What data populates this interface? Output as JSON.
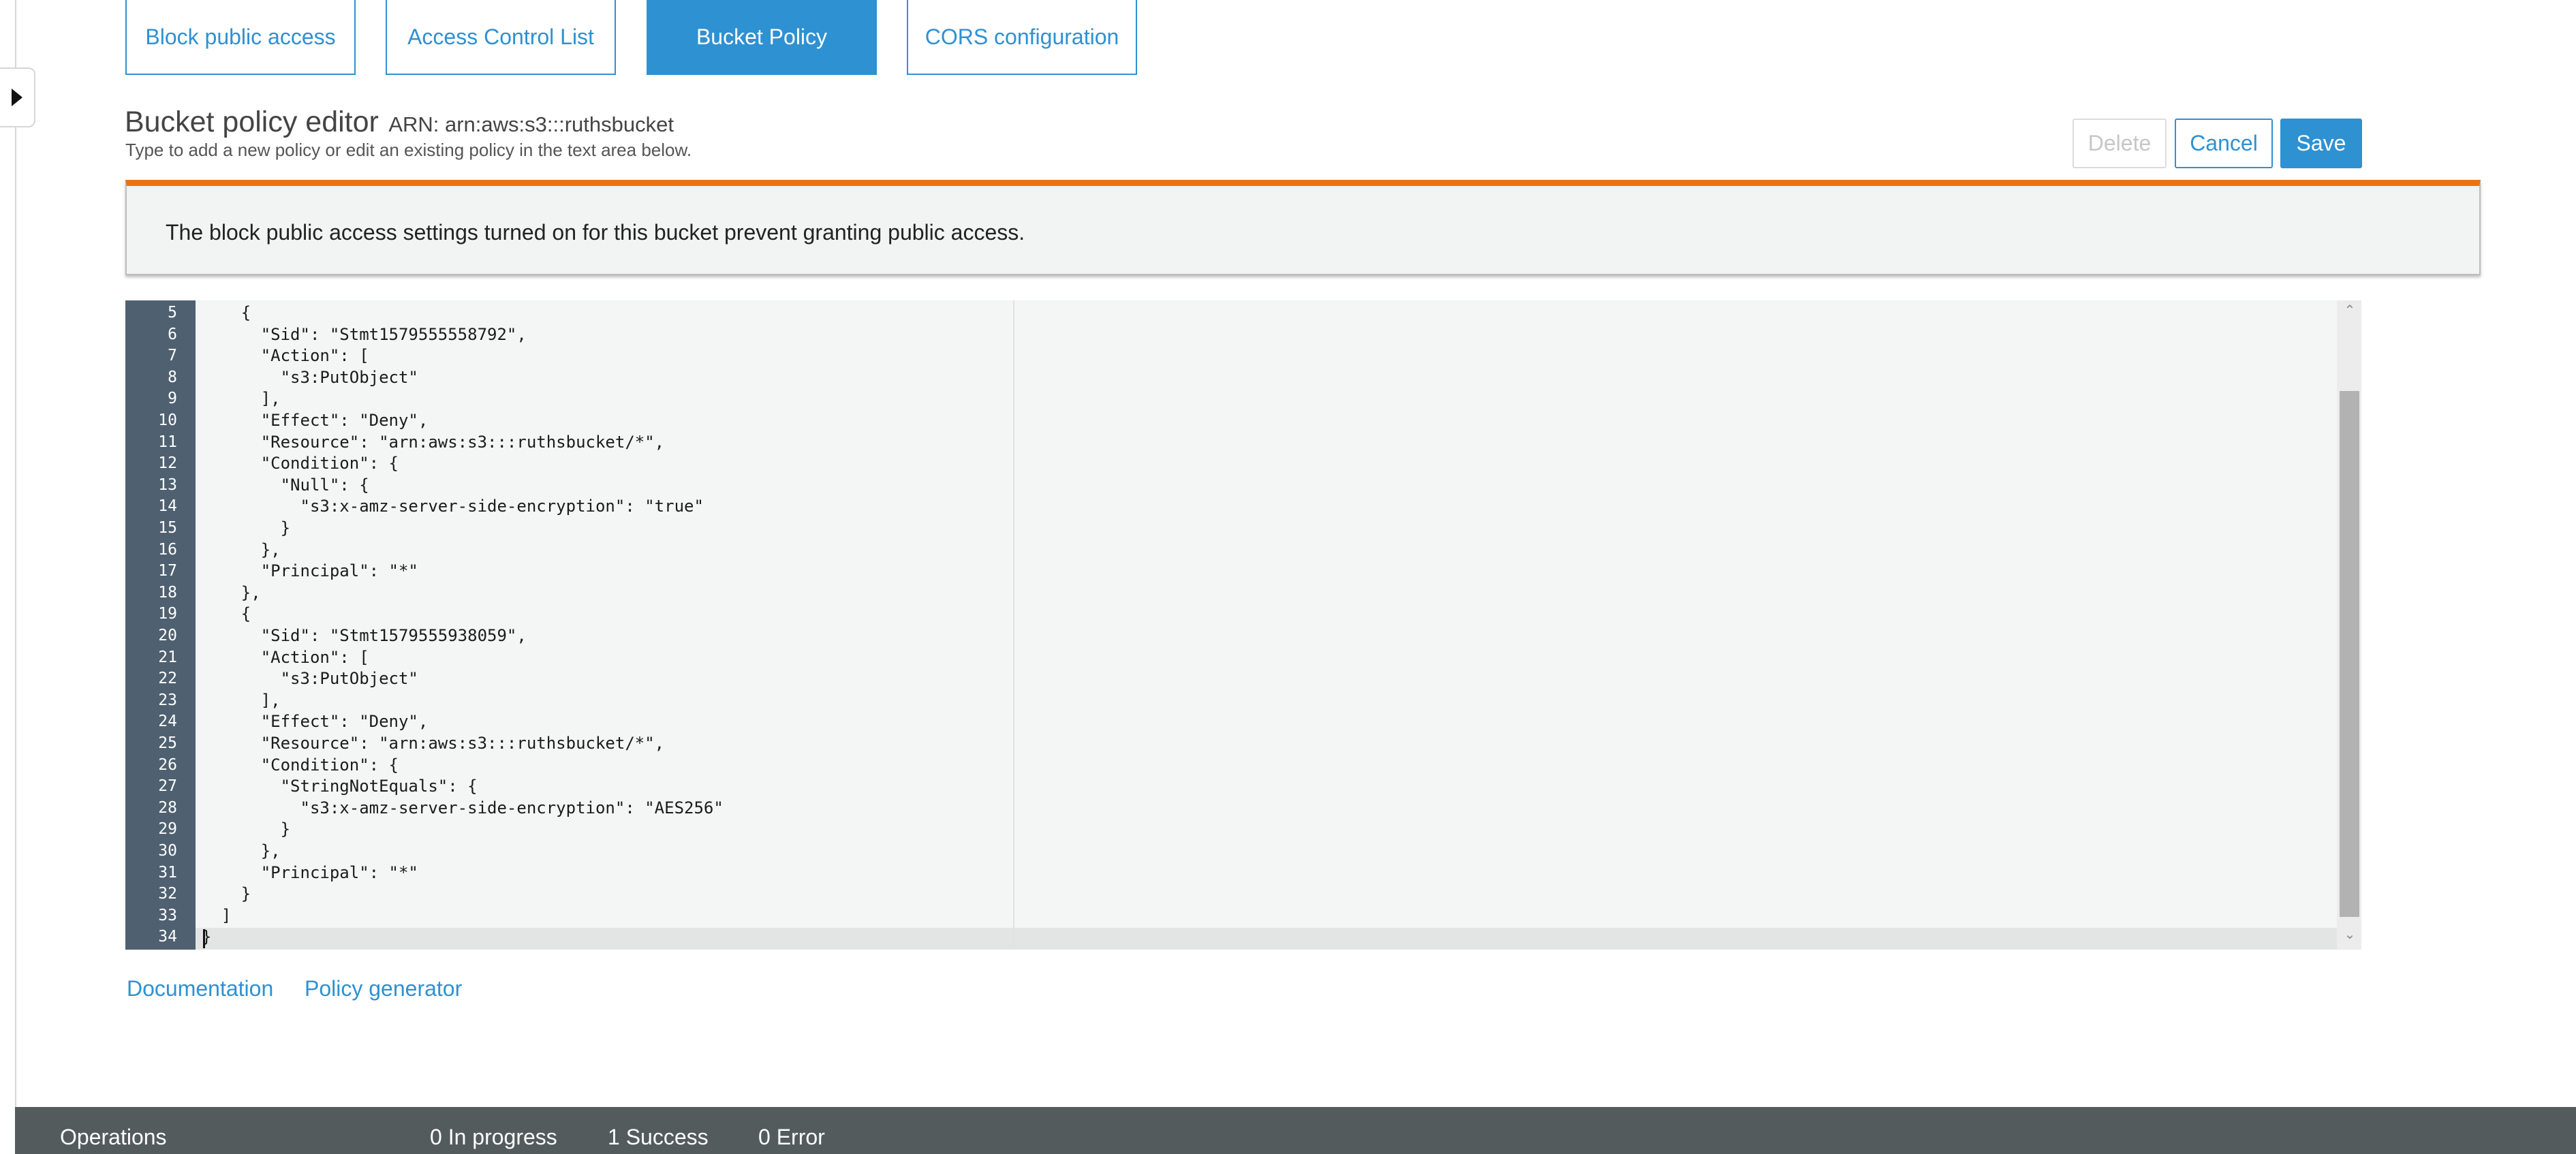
{
  "tabs": [
    {
      "label": "Block public access"
    },
    {
      "label": "Access Control List"
    },
    {
      "label": "Bucket Policy"
    },
    {
      "label": "CORS configuration"
    }
  ],
  "editor_header": {
    "title": "Bucket policy editor",
    "arn": "ARN: arn:aws:s3:::ruthsbucket",
    "subtitle": "Type to add a new policy or edit an existing policy in the text area below."
  },
  "actions": {
    "delete": "Delete",
    "cancel": "Cancel",
    "save": "Save"
  },
  "alert": {
    "message": "The block public access settings turned on for this bucket prevent granting public access.",
    "accent_color": "#ec7211"
  },
  "code": {
    "lines": [
      {
        "n": "5",
        "text": "    {"
      },
      {
        "n": "6",
        "text": "      \"Sid\": \"Stmt1579555558792\","
      },
      {
        "n": "7",
        "text": "      \"Action\": ["
      },
      {
        "n": "8",
        "text": "        \"s3:PutObject\""
      },
      {
        "n": "9",
        "text": "      ],"
      },
      {
        "n": "10",
        "text": "      \"Effect\": \"Deny\","
      },
      {
        "n": "11",
        "text": "      \"Resource\": \"arn:aws:s3:::ruthsbucket/*\","
      },
      {
        "n": "12",
        "text": "      \"Condition\": {"
      },
      {
        "n": "13",
        "text": "        \"Null\": {"
      },
      {
        "n": "14",
        "text": "          \"s3:x-amz-server-side-encryption\": \"true\""
      },
      {
        "n": "15",
        "text": "        }"
      },
      {
        "n": "16",
        "text": "      },"
      },
      {
        "n": "17",
        "text": "      \"Principal\": \"*\""
      },
      {
        "n": "18",
        "text": "    },"
      },
      {
        "n": "19",
        "text": "    {"
      },
      {
        "n": "20",
        "text": "      \"Sid\": \"Stmt1579555938059\","
      },
      {
        "n": "21",
        "text": "      \"Action\": ["
      },
      {
        "n": "22",
        "text": "        \"s3:PutObject\""
      },
      {
        "n": "23",
        "text": "      ],"
      },
      {
        "n": "24",
        "text": "      \"Effect\": \"Deny\","
      },
      {
        "n": "25",
        "text": "      \"Resource\": \"arn:aws:s3:::ruthsbucket/*\","
      },
      {
        "n": "26",
        "text": "      \"Condition\": {"
      },
      {
        "n": "27",
        "text": "        \"StringNotEquals\": {"
      },
      {
        "n": "28",
        "text": "          \"s3:x-amz-server-side-encryption\": \"AES256\""
      },
      {
        "n": "29",
        "text": "        }"
      },
      {
        "n": "30",
        "text": "      },"
      },
      {
        "n": "31",
        "text": "      \"Principal\": \"*\""
      },
      {
        "n": "32",
        "text": "    }"
      },
      {
        "n": "33",
        "text": "  ]"
      },
      {
        "n": "34",
        "text": "}"
      }
    ]
  },
  "links": {
    "documentation": "Documentation",
    "policy_generator": "Policy generator"
  },
  "footer": {
    "title": "Operations",
    "in_progress": "0 In progress",
    "success": "1 Success",
    "error": "0 Error"
  },
  "colors": {
    "accent": "#2e91d2",
    "gutter": "#4f6071",
    "footer": "#545b5d"
  }
}
